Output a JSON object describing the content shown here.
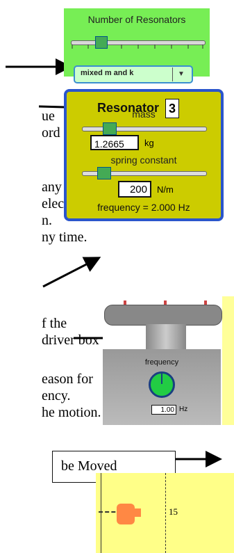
{
  "number_of_resonators": {
    "title": "Number of Resonators",
    "select_value": "mixed m and k",
    "select_arrow": "▼"
  },
  "resonator": {
    "title": "Resonator",
    "number": "3",
    "mass_label": "mass",
    "mass_value": "1.2665",
    "mass_unit": "kg",
    "spring_label": "spring constant",
    "spring_value": "200",
    "spring_unit": "N/m",
    "frequency_readout": "frequency = 2.000 Hz"
  },
  "driver": {
    "frequency_label": "frequency",
    "frequency_value": "1.00",
    "frequency_unit": "Hz"
  },
  "ruler": {
    "label": "15"
  },
  "text_fragments": [
    "ue",
    "ord",
    "any",
    "elect",
    "n.",
    "ny time.",
    "f the",
    "driver box",
    "eason for",
    "ency.",
    "he motion.",
    "be Moved"
  ],
  "colors": {
    "green_panel": "#77ee55",
    "resonator_panel": "#cccc00",
    "resonator_border": "#2a55cc",
    "knob_green": "#22cc44",
    "ruler_yellow": "#ffff88",
    "weight_orange": "#ff8844"
  },
  "icons": [
    "arrow-right-icon",
    "dropdown-arrow-icon",
    "weight-icon"
  ]
}
